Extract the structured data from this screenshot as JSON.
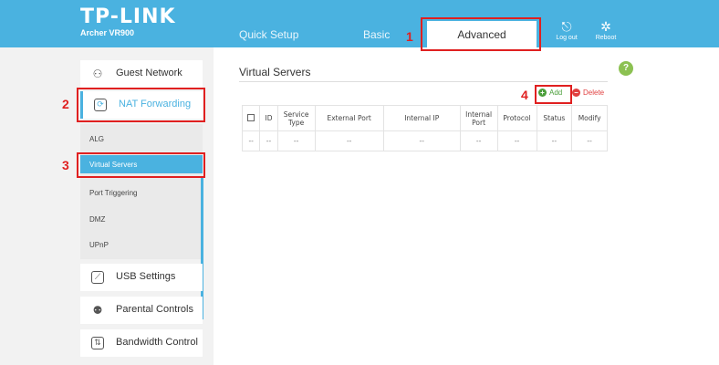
{
  "brand": {
    "name": "TP-LINK",
    "model": "Archer VR900"
  },
  "nav": {
    "quick_setup": "Quick Setup",
    "basic": "Basic",
    "advanced": "Advanced"
  },
  "header_buttons": {
    "logout": "Log out",
    "reboot": "Reboot"
  },
  "sidebar": {
    "guest_network": "Guest Network",
    "nat_forwarding": "NAT Forwarding",
    "submenu": {
      "alg": "ALG",
      "virtual_servers": "Virtual Servers",
      "port_triggering": "Port Triggering",
      "dmz": "DMZ",
      "upnp": "UPnP"
    },
    "usb_settings": "USB Settings",
    "parental_controls": "Parental Controls",
    "bandwidth_control": "Bandwidth Control"
  },
  "content": {
    "title": "Virtual Servers",
    "help": "?",
    "add": "Add",
    "delete": "Delete",
    "columns": [
      "",
      "ID",
      "Service Type",
      "External Port",
      "Internal IP",
      "Internal Port",
      "Protocol",
      "Status",
      "Modify"
    ],
    "row": [
      "--",
      "--",
      "--",
      "--",
      "--",
      "--",
      "--",
      "--",
      "--"
    ]
  },
  "annotations": [
    "1",
    "2",
    "3",
    "4"
  ],
  "colors": {
    "header": "#4ab2e0",
    "accent": "#4ab2e0",
    "annotation": "#e02020",
    "add": "#4a9e3a",
    "delete": "#e04040"
  }
}
